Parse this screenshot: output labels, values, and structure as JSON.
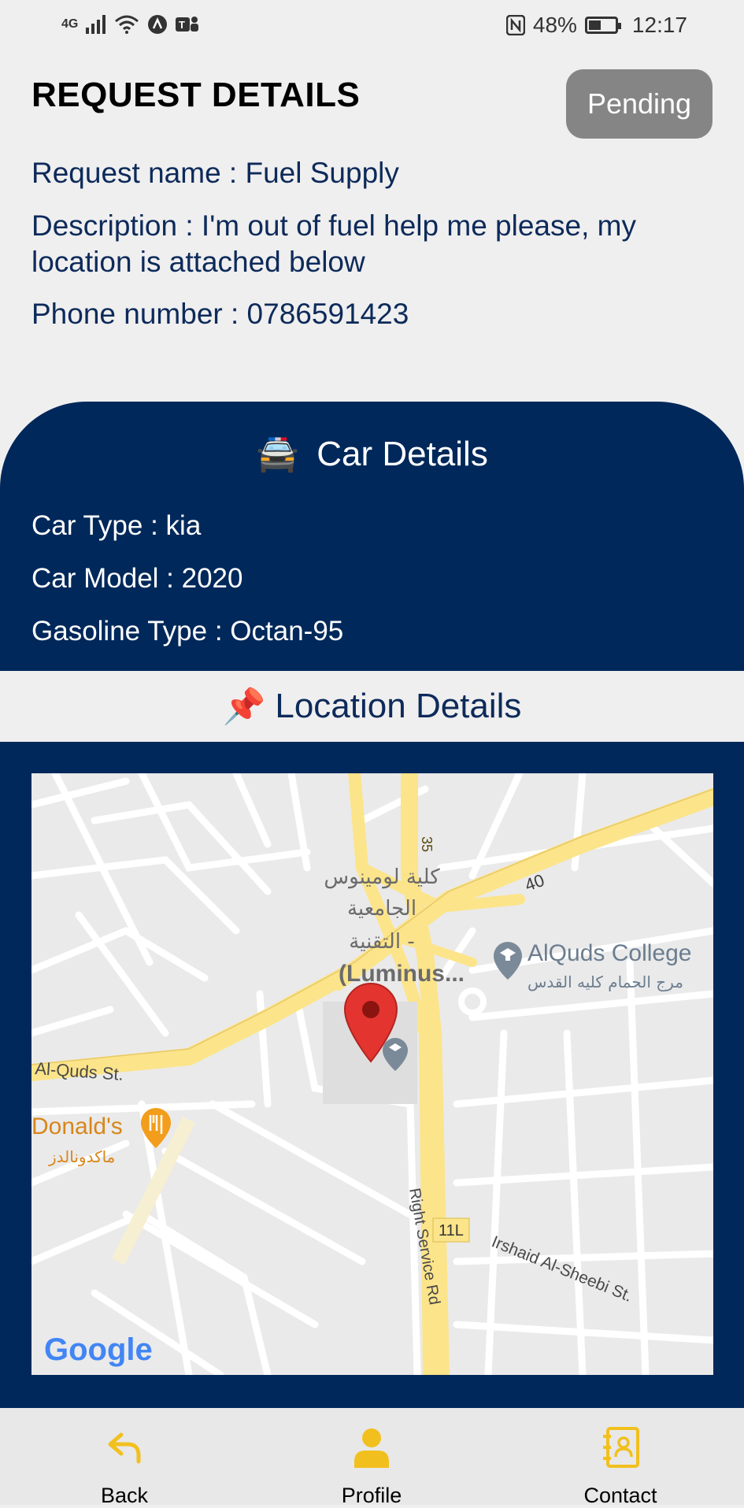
{
  "status_bar": {
    "network": "4G",
    "battery": "48%",
    "battery_level": 0.48,
    "time": "12:17"
  },
  "header": {
    "title": "REQUEST DETAILS",
    "status_badge": "Pending"
  },
  "request": {
    "name_line": "Request name : Fuel Supply",
    "description_line": "Description : I'm out of fuel help me please, my location is attached below",
    "phone_line": "Phone number : 0786591423"
  },
  "car_details": {
    "heading_icon": "🚔",
    "heading": "Car Details",
    "type_line": "Car Type : kia",
    "model_line": "Car Model : 2020",
    "gasoline_line": "Gasoline Type : Octan-95"
  },
  "location_details": {
    "heading_icon": "📌",
    "heading": "Location Details"
  },
  "map": {
    "road_35": "35",
    "road_40": "40",
    "road_11l": "11L",
    "poi_luminus_ar_1": "كلية لومينوس",
    "poi_luminus_ar_2": "الجامعية",
    "poi_luminus_ar_3": "التقنية -",
    "poi_luminus_en": "(Luminus...",
    "poi_alquds_en": "AlQuds College",
    "poi_alquds_ar": "مرج الحمام كليه القدس",
    "street_alquds": "Al-Quds St.",
    "poi_mcdonalds_en": "Donald's",
    "poi_mcdonalds_ar": "ماكدونالدز",
    "street_right_service": "Right Service Rd",
    "street_irshaid": "Irshaid Al-Sheebi St.",
    "google_logo": "Google",
    "colors": {
      "major_road": "#fce48a",
      "minor_road": "#ffffff",
      "land": "#eaeaea",
      "pin": "#e3342f"
    }
  },
  "bottom_nav": {
    "back": "Back",
    "profile": "Profile",
    "contact": "Contact",
    "icon_color": "#f2c01e"
  }
}
